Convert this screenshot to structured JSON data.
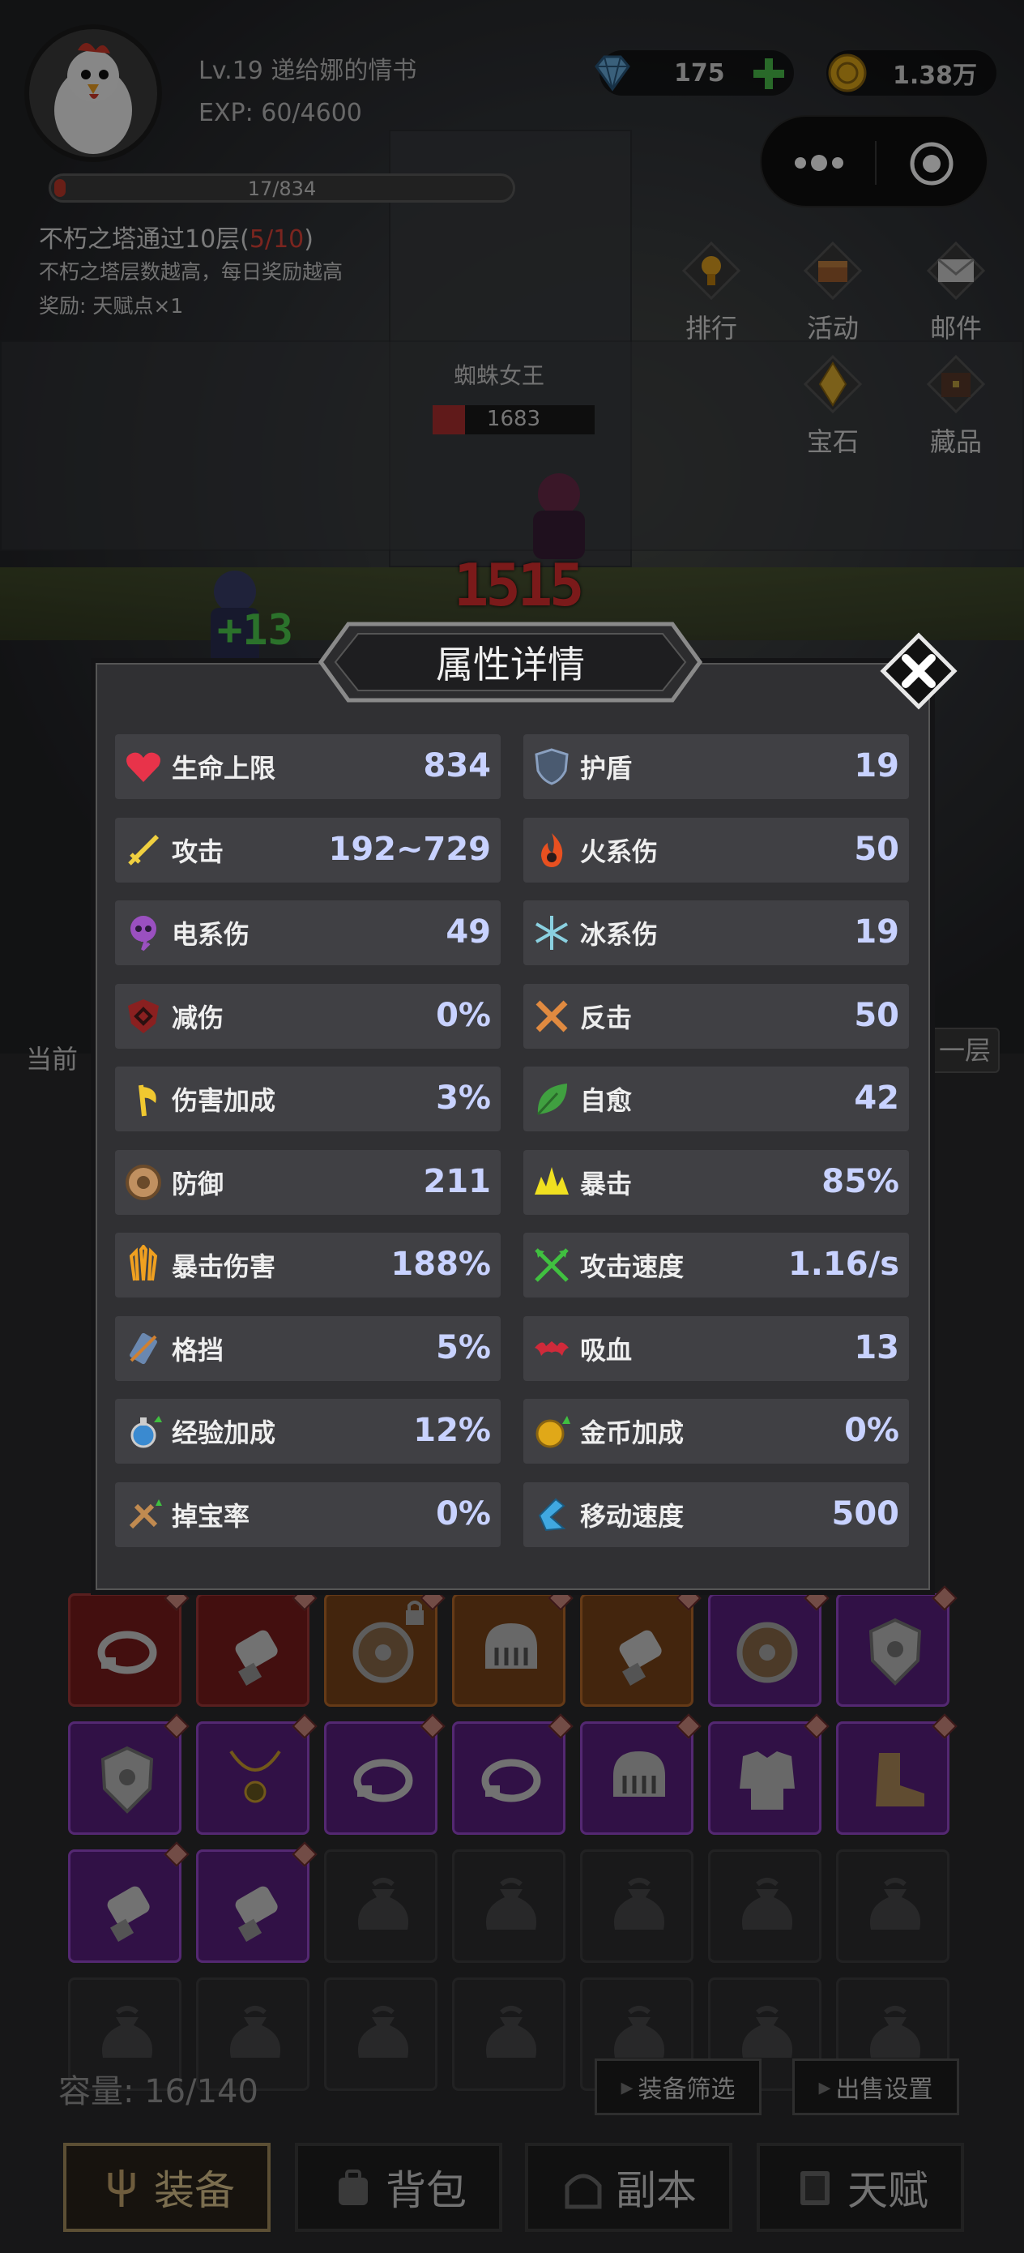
{
  "header": {
    "player_name": "Lv.19 递给娜的情书",
    "exp": "EXP: 60/4600",
    "gems": "175",
    "gold": "1.38万"
  },
  "quest": {
    "progress_text": "17/834",
    "progress_fraction": 0.02,
    "title_prefix": "不朽之塔通过10层(",
    "title_progress": "5/10",
    "title_suffix": ")",
    "desc": "不朽之塔层数越高，每日奖励越高",
    "reward": "奖励: 天赋点×1"
  },
  "side_buttons": {
    "rank": "排行",
    "activity": "活动",
    "mail": "邮件",
    "gem": "宝石",
    "collection": "藏品"
  },
  "battle": {
    "boss_name": "蜘蛛女王",
    "boss_hp": "1683",
    "damage": "1515",
    "heal": "+13"
  },
  "background_text": {
    "left": "当前",
    "right": "一层"
  },
  "modal": {
    "title": "属性详情",
    "stats": [
      {
        "name": "生命上限",
        "value": "834",
        "icon": "heart-icon"
      },
      {
        "name": "护盾",
        "value": "19",
        "icon": "shield-icon"
      },
      {
        "name": "攻击",
        "value": "192~729",
        "icon": "sword-icon"
      },
      {
        "name": "火系伤",
        "value": "50",
        "icon": "fire-icon"
      },
      {
        "name": "电系伤",
        "value": "49",
        "icon": "lightning-skull-icon"
      },
      {
        "name": "冰系伤",
        "value": "19",
        "icon": "snowflake-icon"
      },
      {
        "name": "减伤",
        "value": "0%",
        "icon": "damage-reduction-icon"
      },
      {
        "name": "反击",
        "value": "50",
        "icon": "crossed-swords-icon"
      },
      {
        "name": "伤害加成",
        "value": "3%",
        "icon": "axe-icon"
      },
      {
        "name": "自愈",
        "value": "42",
        "icon": "leaf-icon"
      },
      {
        "name": "防御",
        "value": "211",
        "icon": "round-shield-icon"
      },
      {
        "name": "暴击",
        "value": "85%",
        "icon": "crit-burst-icon"
      },
      {
        "name": "暴击伤害",
        "value": "188%",
        "icon": "blades-icon"
      },
      {
        "name": "攻击速度",
        "value": "1.16/s",
        "icon": "arrows-icon"
      },
      {
        "name": "格挡",
        "value": "5%",
        "icon": "block-shield-icon"
      },
      {
        "name": "吸血",
        "value": "13",
        "icon": "bat-icon"
      },
      {
        "name": "经验加成",
        "value": "12%",
        "icon": "exp-potion-icon"
      },
      {
        "name": "金币加成",
        "value": "0%",
        "icon": "coin-bonus-icon"
      },
      {
        "name": "掉宝率",
        "value": "0%",
        "icon": "loot-icon"
      },
      {
        "name": "移动速度",
        "value": "500",
        "icon": "boot-speed-icon"
      }
    ]
  },
  "inventory": {
    "capacity": "容量: 16/140",
    "filter_button": "装备筛选",
    "sell_button": "出售设置",
    "slots": [
      {
        "rarity": "red",
        "item": "ring"
      },
      {
        "rarity": "red",
        "item": "gauntlet"
      },
      {
        "rarity": "orange",
        "item": "round-shield",
        "locked": true
      },
      {
        "rarity": "orange",
        "item": "helmet"
      },
      {
        "rarity": "orange",
        "item": "gauntlet"
      },
      {
        "rarity": "purple",
        "item": "round-shield"
      },
      {
        "rarity": "purple",
        "item": "kite-shield"
      },
      {
        "rarity": "purple",
        "item": "kite-shield"
      },
      {
        "rarity": "purple",
        "item": "necklace"
      },
      {
        "rarity": "purple",
        "item": "ring"
      },
      {
        "rarity": "purple",
        "item": "ring"
      },
      {
        "rarity": "purple",
        "item": "helmet"
      },
      {
        "rarity": "purple",
        "item": "armor"
      },
      {
        "rarity": "purple",
        "item": "boot"
      },
      {
        "rarity": "purple",
        "item": "gauntlet"
      },
      {
        "rarity": "purple",
        "item": "gauntlet"
      },
      {
        "rarity": "empty"
      },
      {
        "rarity": "empty"
      },
      {
        "rarity": "empty"
      },
      {
        "rarity": "empty"
      },
      {
        "rarity": "empty"
      },
      {
        "rarity": "empty"
      },
      {
        "rarity": "empty"
      },
      {
        "rarity": "empty"
      },
      {
        "rarity": "empty"
      },
      {
        "rarity": "empty"
      },
      {
        "rarity": "empty"
      },
      {
        "rarity": "empty"
      }
    ]
  },
  "tabs": [
    {
      "label": "装备",
      "active": true
    },
    {
      "label": "背包",
      "active": false
    },
    {
      "label": "副本",
      "active": false
    },
    {
      "label": "天赋",
      "active": false
    }
  ],
  "colors": {
    "stat_value": "#c8d2ff",
    "modal_bg": "#303033",
    "rarity_red": "#7a1c1c",
    "rarity_orange": "#7a4418",
    "rarity_purple": "#5a2080"
  }
}
